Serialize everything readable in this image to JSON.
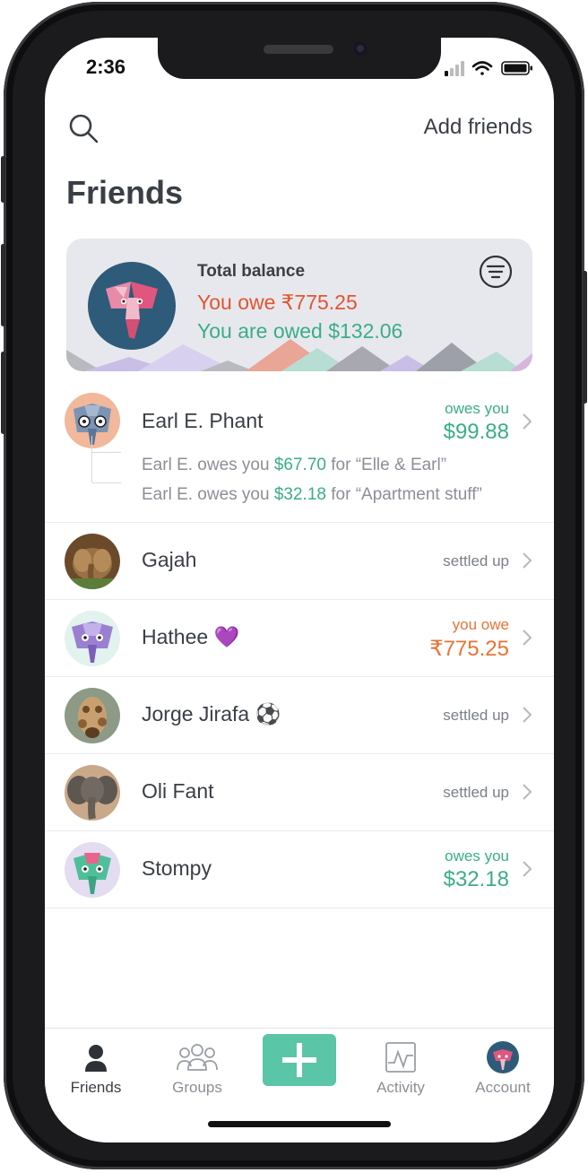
{
  "status_bar": {
    "time": "2:36"
  },
  "header": {
    "add_friends": "Add friends",
    "title": "Friends"
  },
  "balance": {
    "label": "Total balance",
    "you_owe": "You owe ₹775.25",
    "you_are_owed": "You are owed $132.06",
    "owe_color": "#e2552f",
    "owed_color": "#3aae83"
  },
  "friends": [
    {
      "name": "Earl E. Phant",
      "status": "owes you",
      "amount": "$99.88",
      "details": [
        {
          "prefix": "Earl E. owes you ",
          "amount": "$67.70",
          "suffix": " for “Elle & Earl”"
        },
        {
          "prefix": "Earl E. owes you ",
          "amount": "$32.18",
          "suffix": " for “Apartment stuff”"
        }
      ]
    },
    {
      "name": "Gajah",
      "status": "settled up"
    },
    {
      "name": "Hathee 💜",
      "status": "you owe",
      "amount": "₹775.25"
    },
    {
      "name": "Jorge Jirafa ⚽",
      "status": "settled up"
    },
    {
      "name": "Oli Fant",
      "status": "settled up"
    },
    {
      "name": "Stompy",
      "status": "owes you",
      "amount": "$32.18"
    }
  ],
  "tabs": [
    {
      "label": "Friends",
      "icon": "person-icon",
      "active": true
    },
    {
      "label": "Groups",
      "icon": "group-icon",
      "active": false
    },
    {
      "label": "",
      "icon": "plus-icon",
      "active": false
    },
    {
      "label": "Activity",
      "icon": "activity-icon",
      "active": false
    },
    {
      "label": "Account",
      "icon": "account-avatar",
      "active": false
    }
  ],
  "colors": {
    "accent": "#5bc5a7",
    "positive": "#3aae83",
    "negative": "#e87331",
    "text": "#3a3f45"
  }
}
